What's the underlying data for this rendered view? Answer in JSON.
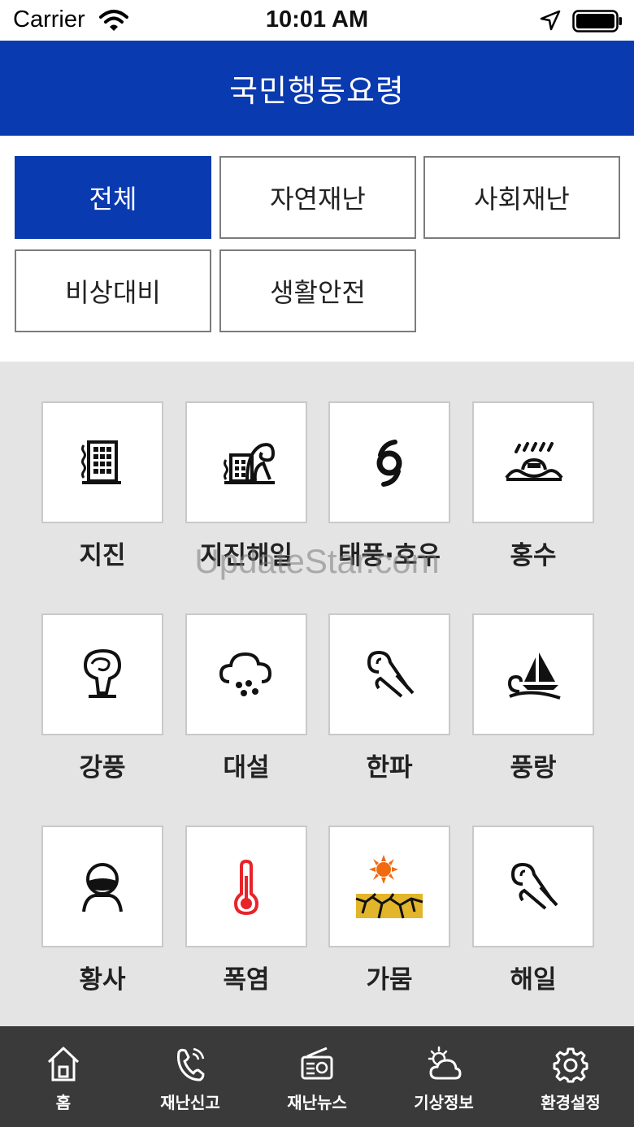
{
  "status_bar": {
    "carrier": "Carrier",
    "time": "10:01 AM"
  },
  "header": {
    "title": "국민행동요령"
  },
  "filters": [
    {
      "label": "전체",
      "active": true
    },
    {
      "label": "자연재난",
      "active": false
    },
    {
      "label": "사회재난",
      "active": false
    },
    {
      "label": "비상대비",
      "active": false
    },
    {
      "label": "생활안전",
      "active": false
    }
  ],
  "tiles": [
    {
      "label": "지진",
      "icon": "building-icon"
    },
    {
      "label": "지진해일",
      "icon": "tsunami-icon"
    },
    {
      "label": "태풍·호우",
      "icon": "typhoon-icon"
    },
    {
      "label": "홍수",
      "icon": "flood-icon"
    },
    {
      "label": "강풍",
      "icon": "tornado-icon"
    },
    {
      "label": "대설",
      "icon": "snow-cloud-icon"
    },
    {
      "label": "한파",
      "icon": "cold-wind-icon"
    },
    {
      "label": "풍랑",
      "icon": "sailboat-icon"
    },
    {
      "label": "황사",
      "icon": "mask-person-icon"
    },
    {
      "label": "폭염",
      "icon": "thermometer-icon"
    },
    {
      "label": "가뭄",
      "icon": "drought-icon"
    },
    {
      "label": "해일",
      "icon": "wave-wind-icon"
    }
  ],
  "watermark": "UpdateStar.com",
  "tabs": [
    {
      "label": "홈",
      "icon": "home-icon"
    },
    {
      "label": "재난신고",
      "icon": "phone-icon"
    },
    {
      "label": "재난뉴스",
      "icon": "radio-icon"
    },
    {
      "label": "기상정보",
      "icon": "weather-icon"
    },
    {
      "label": "환경설정",
      "icon": "gear-icon"
    }
  ],
  "colors": {
    "primary": "#0a3ab0",
    "tab_bar": "#3a3a3a",
    "grid_bg": "#e4e4e4",
    "heat_red": "#e8232a",
    "sun_orange": "#f26a10",
    "drought_yellow": "#e2b52a"
  }
}
